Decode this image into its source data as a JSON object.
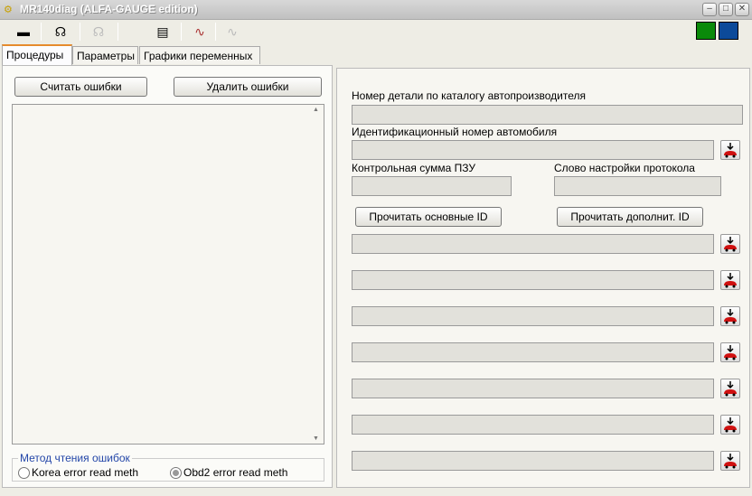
{
  "window": {
    "title": "MR140diag (ALFA-GAUGE edition)"
  },
  "toolbar": {
    "indicator_colors": [
      "#0a8a0a",
      "#0c4a9a"
    ]
  },
  "tabs": [
    {
      "label": "Процедуры"
    },
    {
      "label": "Параметры"
    },
    {
      "label": "Графики переменных"
    }
  ],
  "left": {
    "read_errors": "Считать ошибки",
    "clear_errors": "Удалить ошибки",
    "method_group": "Метод чтения ошибок",
    "radio_korea": "Korea error read meth",
    "radio_obd2": "Obd2 error read meth",
    "selected": "obd2"
  },
  "right": {
    "part_number_label": "Номер детали по каталогу автопроизводителя",
    "vin_label": "Идентификационный номер автомобиля",
    "checksum_label": "Контрольная сумма ПЗУ",
    "protocol_label": "Слово настройки протокола",
    "read_main_id": "Прочитать основные ID",
    "read_extra_id": "Прочитать дополнит. ID"
  }
}
